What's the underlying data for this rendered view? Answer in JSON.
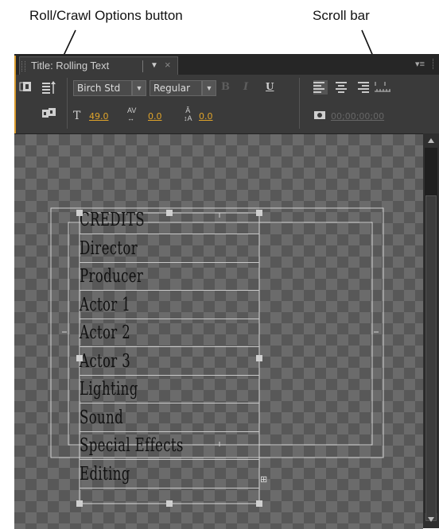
{
  "callouts": {
    "roll_crawl": "Roll/Crawl Options button",
    "scroll_bar": "Scroll bar"
  },
  "tab": {
    "title": "Title: Rolling Text",
    "close": "×"
  },
  "toolbar": {
    "font_family": "Birch Std",
    "font_style": "Regular",
    "bold": "B",
    "italic": "I",
    "underline": "U",
    "font_size": "49.0",
    "kerning": "0.0",
    "leading": "0.0",
    "timecode": "00;00;00;00"
  },
  "credits": [
    "CREDITS",
    "Director",
    "Producer",
    "Actor 1",
    "Actor 2",
    "Actor 3",
    "Lighting",
    "Sound",
    "Special Effects",
    "Editing"
  ],
  "colors": {
    "accent": "#e0a42a",
    "panel": "#3a3a3a",
    "border": "#d89a2c"
  }
}
